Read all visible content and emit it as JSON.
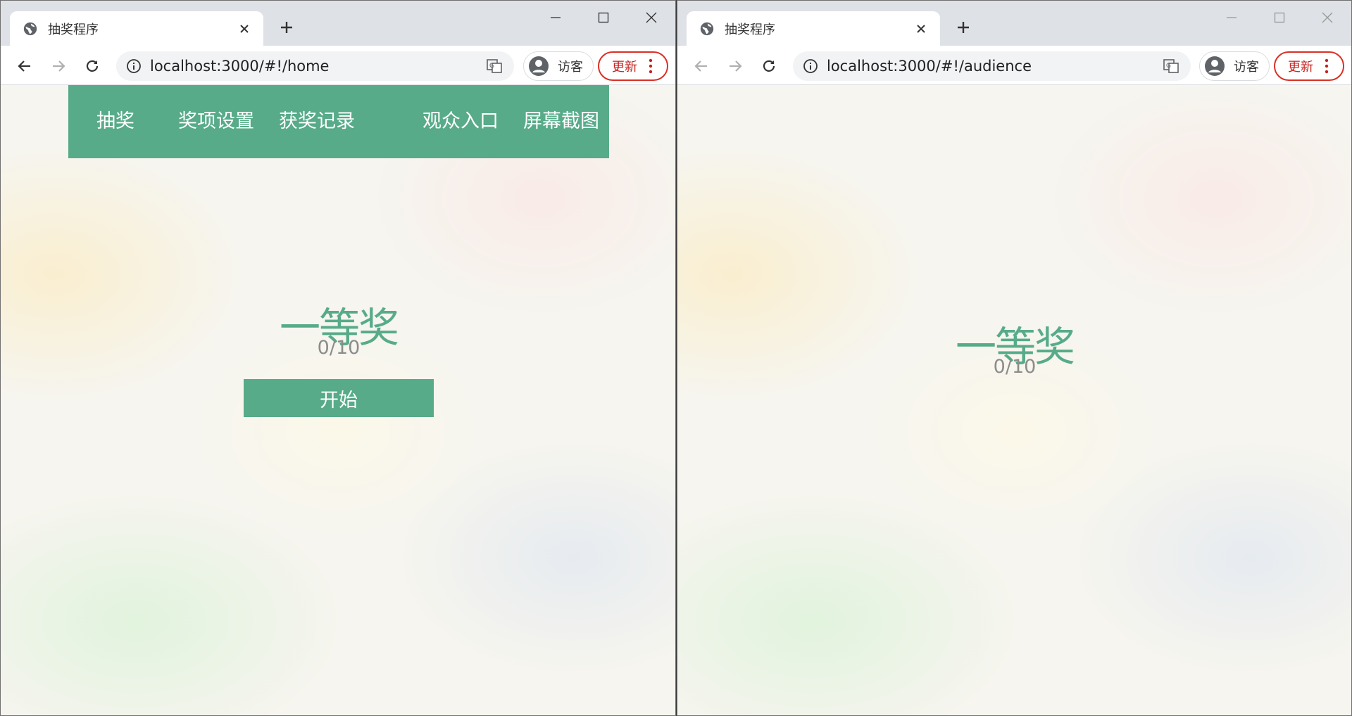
{
  "left_window": {
    "tab": {
      "title": "抽奖程序",
      "close_icon": "close-icon",
      "icon": "globe-icon"
    },
    "toolbar": {
      "url": "localhost:3000/#!/home",
      "profile_label": "访客",
      "update_label": "更新"
    },
    "navbar": {
      "items": [
        {
          "label": "抽奖"
        },
        {
          "label": "奖项设置"
        },
        {
          "label": "获奖记录"
        },
        {
          "label": "观众入口"
        },
        {
          "label": "屏幕截图"
        }
      ]
    },
    "prize": {
      "title": "一等奖",
      "count": "0/10",
      "start_label": "开始"
    }
  },
  "right_window": {
    "tab": {
      "title": "抽奖程序",
      "close_icon": "close-icon",
      "icon": "globe-icon"
    },
    "toolbar": {
      "url": "localhost:3000/#!/audience",
      "profile_label": "访客",
      "update_label": "更新"
    },
    "prize": {
      "title": "一等奖",
      "count": "0/10"
    }
  },
  "colors": {
    "accent": "#57ab89",
    "update_red": "#d93025",
    "count_gray": "#8c8c8c"
  }
}
